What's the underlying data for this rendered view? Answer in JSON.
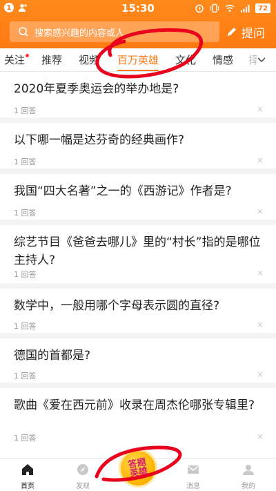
{
  "status_bar": {
    "notification_count": "1",
    "time": "15:30",
    "battery": "72"
  },
  "search": {
    "placeholder": "搜索感兴趣的内容或人"
  },
  "ask_button": {
    "label": "提问"
  },
  "tabs": [
    {
      "label": "关注",
      "has_dot": true
    },
    {
      "label": "推荐"
    },
    {
      "label": "视频"
    },
    {
      "label": "百万英雄",
      "active": true
    },
    {
      "label": "文化"
    },
    {
      "label": "情感"
    },
    {
      "label": "择"
    }
  ],
  "questions": [
    {
      "title": "2020年夏季奥运会的举办地是?",
      "answers": "1 回答"
    },
    {
      "title": "以下哪一幅是达芬奇的经典画作?",
      "answers": "1 回答"
    },
    {
      "title": "我国“四大名著”之一的《西游记》作者是?",
      "answers": "1 回答"
    },
    {
      "title": "综艺节目《爸爸去哪儿》里的“村长”指的是哪位主持人?",
      "answers": "1 回答"
    },
    {
      "title": "数学中，一般用哪个字母表示圆的直径?",
      "answers": "1 回答"
    },
    {
      "title": "德国的首都是?",
      "answers": "1 回答"
    },
    {
      "title": "歌曲《爱在西元前》收录在周杰伦哪张专辑里?",
      "answers": "1 回答"
    }
  ],
  "dismiss_glyph": "×",
  "bottom_nav": [
    {
      "label": "首页",
      "icon": "home-icon",
      "active": true
    },
    {
      "label": "发现",
      "icon": "compass-icon"
    },
    {
      "label": "消息",
      "icon": "mail-icon"
    },
    {
      "label": "我的",
      "icon": "profile-icon"
    }
  ],
  "center_badge": {
    "line1": "答题",
    "line2": "英雄"
  },
  "colors": {
    "accent": "#ff7a12",
    "annotation": "#e8001c",
    "badge": "#ffb400"
  }
}
